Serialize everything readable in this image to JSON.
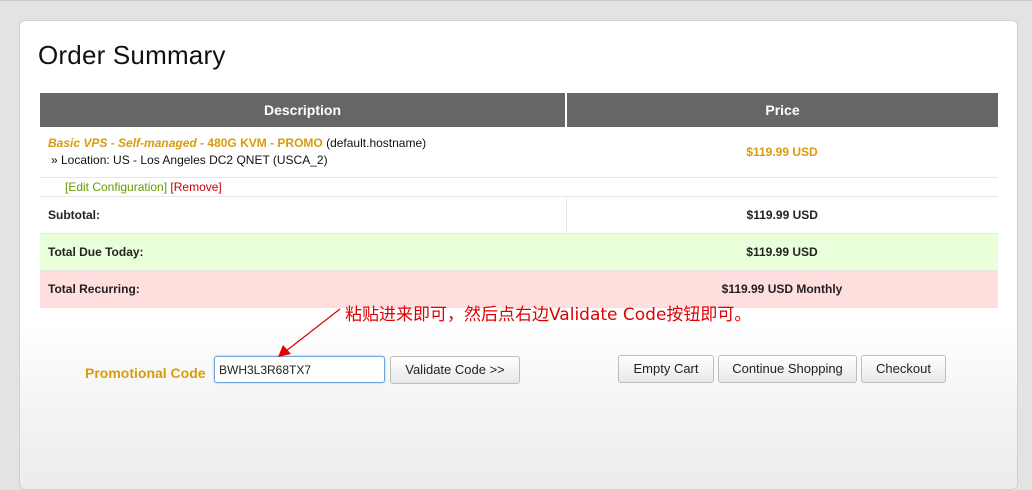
{
  "page": {
    "title": "Order Summary"
  },
  "table": {
    "headers": {
      "description": "Description",
      "price": "Price"
    },
    "item": {
      "product_name": "Basic VPS - Self-managed",
      "product_sep": " - ",
      "product_promo": "480G KVM - PROMO",
      "hostname": " (default.hostname)",
      "location": "» Location: US - Los Angeles DC2 QNET (USCA_2)",
      "price": "$119.99 USD",
      "edit_label": "[Edit Configuration]",
      "remove_label": "[Remove]"
    },
    "subtotal": {
      "label": "Subtotal:",
      "value": "$119.99 USD"
    },
    "total_due_today": {
      "label": "Total Due Today:",
      "value": "$119.99 USD"
    },
    "total_recurring": {
      "label": "Total Recurring:",
      "value": "$119.99 USD Monthly"
    }
  },
  "promo": {
    "label": "Promotional Code",
    "value": "BWH3L3R68TX7",
    "validate_label": "Validate Code >>"
  },
  "actions": {
    "empty_cart": "Empty Cart",
    "continue_shopping": "Continue Shopping",
    "checkout": "Checkout"
  },
  "annotation": {
    "text": "粘贴进来即可，然后点右边Validate Code按钮即可。",
    "color": "#e00000"
  },
  "colors": {
    "header_bg": "#666666",
    "accent": "#d99b0c",
    "due_today_bg": "#e8ffd9",
    "recurring_bg": "#ffdede",
    "edit_link": "#669900",
    "remove_link": "#cc0000"
  }
}
